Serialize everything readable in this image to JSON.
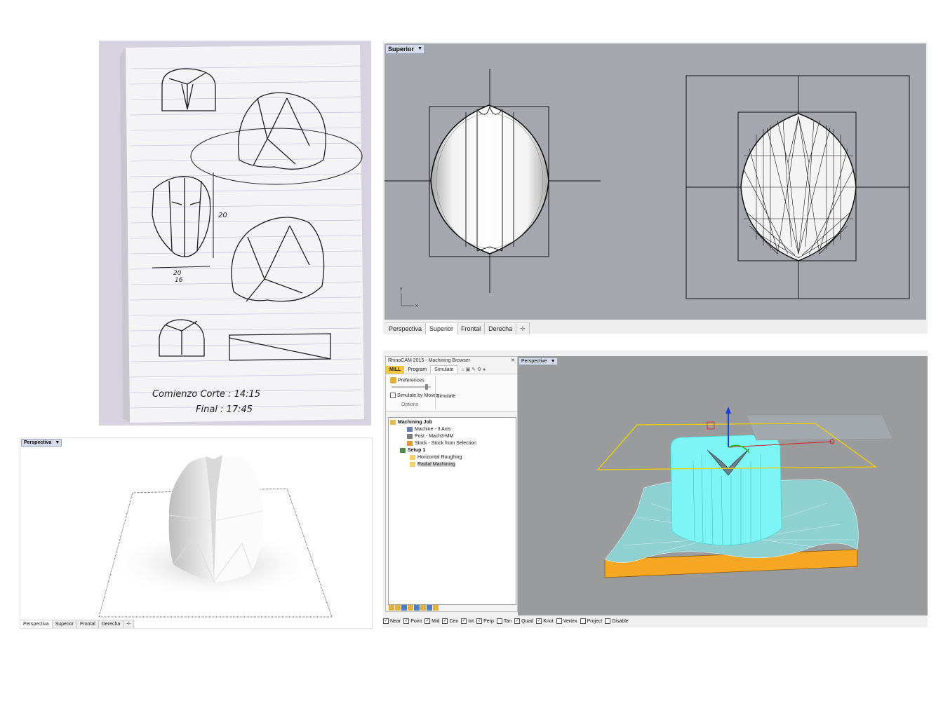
{
  "sketch": {
    "notes_line1": "Comienzo Corte : 14:15",
    "notes_line2": "Final : 17:45",
    "dim_height": "20",
    "dim_width_1": "20",
    "dim_width_2": "16"
  },
  "top_viewport": {
    "label": "Superior",
    "tabs": [
      "Perspectiva",
      "Superior",
      "Frontal",
      "Derecha"
    ],
    "active_tab": 1,
    "axis_y": "y",
    "axis_x": "x"
  },
  "render_viewport": {
    "label": "Perspectiva",
    "tabs": [
      "Perspectiva",
      "Superior",
      "Frontal",
      "Derecha"
    ],
    "active_tab": 0
  },
  "cam": {
    "title": "RhinoCAM 2015 - Machining Browser",
    "ribbon_tabs": [
      "MILL",
      "Program",
      "Simulate"
    ],
    "active_tab": 2,
    "preferences_label": "Preferences",
    "simulate_by_moves": "Simulate by Moves",
    "simulate_label": "Simulate",
    "options_label": "Options",
    "tree": {
      "machining_job": "Machining Job",
      "machine": "Machine - 3 Axis",
      "post": "Post - Mach3-MM",
      "stock": "Stock - Stock from Selection",
      "setup": "Setup 1",
      "horizontal": "Horizontal Roughing",
      "radial": "Radial Machining"
    },
    "viewport_label": "Perspective",
    "snaps": [
      "Near",
      "Point",
      "Mid",
      "Cen",
      "Int",
      "Perp",
      "Tan",
      "Quad",
      "Knot",
      "Vertex",
      "Project",
      "Disable"
    ],
    "snaps_checked": [
      true,
      true,
      true,
      true,
      true,
      true,
      false,
      true,
      true,
      false,
      false,
      false
    ],
    "colors": {
      "mill_tab": "#f4c63f",
      "cyan_model": "#7ef5f5",
      "stock_orange": "#f5a623",
      "selection_yellow": "#f0d000"
    }
  }
}
